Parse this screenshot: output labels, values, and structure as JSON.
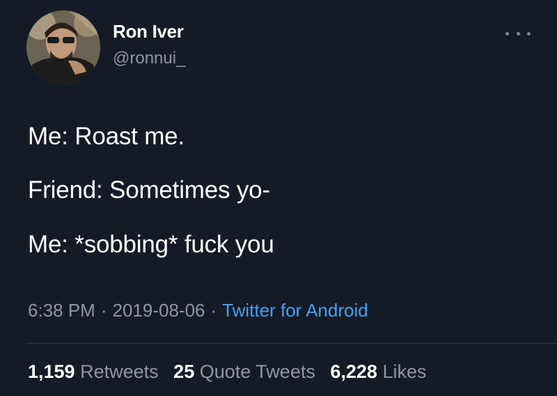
{
  "user": {
    "name": "Ron Iver",
    "handle": "@ronnui_"
  },
  "menu_icon": "more-horizontal-icon",
  "tweet": {
    "lines": [
      "Me: Roast me.",
      "Friend: Sometimes yo-",
      "Me: *sobbing* fuck you"
    ],
    "time": "6:38 PM",
    "separator": "·",
    "date": "2019-08-06",
    "source": "Twitter for Android"
  },
  "stats": {
    "retweets": {
      "count": "1,159",
      "label": "Retweets"
    },
    "quote_tweets": {
      "count": "25",
      "label": "Quote Tweets"
    },
    "likes": {
      "count": "6,228",
      "label": "Likes"
    }
  },
  "colors": {
    "background": "#151b26",
    "text": "#ffffff",
    "secondary": "#8b98a5",
    "link": "#4b9ff0"
  }
}
